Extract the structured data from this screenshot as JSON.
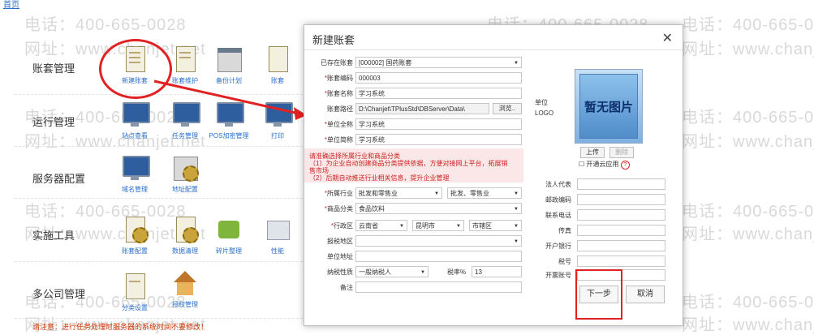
{
  "nav": {
    "home": "首页"
  },
  "watermark": {
    "phone": "电话：400-665-0028",
    "site": "网址：www.chanjet.net"
  },
  "modules": [
    {
      "title": "账套管理",
      "tools": [
        "新建账套",
        "账套维护",
        "备份计划",
        "账套"
      ]
    },
    {
      "title": "运行管理",
      "tools": [
        "站点查看",
        "任务管理",
        "POS加密管理",
        "打印"
      ]
    },
    {
      "title": "服务器配置",
      "tools": [
        "域名管理",
        "地址配置"
      ]
    },
    {
      "title": "实施工具",
      "tools": [
        "账套配置",
        "数据清理",
        "碎片整理",
        "性能"
      ]
    },
    {
      "title": "多公司管理",
      "tools": [
        "分类设置",
        "授权管理"
      ]
    }
  ],
  "notice": "请注意：进行任务处理时服务器的系统时间不要修改！",
  "dialog": {
    "title": "新建账套",
    "close": "✕",
    "fields": {
      "existing": {
        "label": "已存在账套",
        "value": "[000002] 国药账套"
      },
      "code": {
        "label": "账套编码",
        "value": "000003"
      },
      "name": {
        "label": "账套名称",
        "value": "学习系统"
      },
      "path": {
        "label": "账套路径",
        "value": "D:\\Chanjet\\TPlusStd\\DBServer\\Data\\",
        "browse": "浏览.."
      },
      "fullname": {
        "label": "单位全称",
        "value": "学习系统"
      },
      "shortname": {
        "label": "单位简称",
        "value": "学习系统"
      },
      "industry": {
        "label": "所属行业",
        "value": "批发和零售业",
        "sub": "批发、零售业"
      },
      "category": {
        "label": "商品分类",
        "value": "食品饮料"
      },
      "region": {
        "label": "行政区",
        "province": "云南省",
        "city": "昆明市",
        "district": "市辖区"
      },
      "tax_region": {
        "label": "报税地区",
        "value": ""
      },
      "address": {
        "label": "单位地址",
        "value": ""
      },
      "taxpayer": {
        "label": "纳税性质",
        "value": "一般纳税人",
        "rate_label": "税率%",
        "rate": "13"
      },
      "remark": {
        "label": "备注",
        "value": ""
      },
      "legal": {
        "label": "法人代表",
        "value": ""
      },
      "postcode": {
        "label": "邮政编码",
        "value": ""
      },
      "phone": {
        "label": "联系电话",
        "value": ""
      },
      "fax": {
        "label": "传真",
        "value": ""
      },
      "bank": {
        "label": "开户银行",
        "value": ""
      },
      "taxno": {
        "label": "税号",
        "value": ""
      },
      "account": {
        "label": "开票账号",
        "value": ""
      }
    },
    "hint": [
      "请准确选择所属行业和商品分类",
      "（1）为企业自动创建商品分类提供依据，方便对接网上平台，拓展销",
      "售市场",
      "（2）后期自动推送行业相关信息，提升企业管理"
    ],
    "logo": {
      "label1": "单位",
      "label2": "LOGO",
      "placeholder": "暂无图片",
      "upload": "上传",
      "delete": "删除",
      "cloud": "开通云应用",
      "q": "?"
    },
    "next": "下一步",
    "cancel": "取消"
  }
}
